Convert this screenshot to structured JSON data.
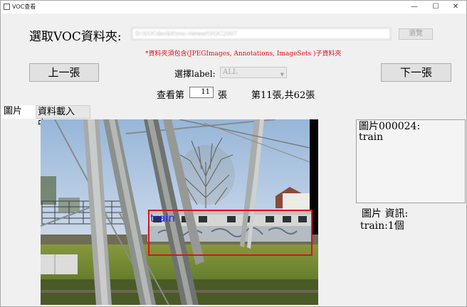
{
  "window": {
    "title": "VOC查看",
    "minimize_glyph": "—",
    "maximize_glyph": "☐",
    "close_glyph": "✕"
  },
  "folder": {
    "label": "選取VOC資料夾:",
    "path_value": "D:\\VOCdevkit\\voc-viewer\\VOC2007",
    "browse_label": "瀏覽"
  },
  "hint": "*資料夾須包含(JPEGImages, Annotations, ImageSets )子資料夾",
  "nav": {
    "prev_label": "上一張",
    "next_label": "下一張",
    "label_select_caption": "選擇label:",
    "label_select_value": "ALL"
  },
  "pager": {
    "prefix": "查看第",
    "current_value": "11",
    "suffix": "張",
    "status": "第11張,共62張"
  },
  "tabs": {
    "image_label": "圖片",
    "loading_text": "資料載入中.."
  },
  "photo": {
    "box_label": "train",
    "box_color": "#e0101c",
    "label_color": "#1a22ff"
  },
  "info_box": {
    "line1": "圖片000024:",
    "line2": "train"
  },
  "image_info": {
    "title": "圖片 資訊:",
    "detail": "train:1個"
  }
}
